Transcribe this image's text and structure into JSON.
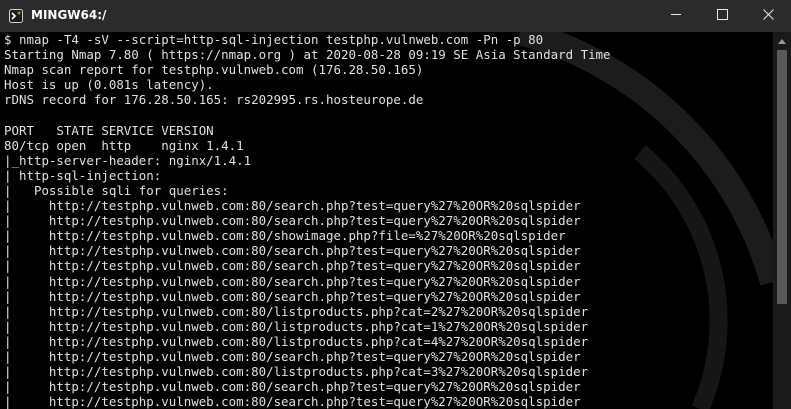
{
  "window": {
    "title": "MINGW64:/",
    "accent": "#2b2b2b"
  },
  "icons": {
    "app": "mingw-terminal-icon",
    "minimize": "minimize-icon",
    "maximize": "maximize-icon",
    "close": "close-icon",
    "scroll_up": "chevron-up-icon"
  },
  "terminal": {
    "lines": [
      "$ nmap -T4 -sV --script=http-sql-injection testphp.vulnweb.com -Pn -p 80",
      "Starting Nmap 7.80 ( https://nmap.org ) at 2020-08-28 09:19 SE Asia Standard Time",
      "Nmap scan report for testphp.vulnweb.com (176.28.50.165)",
      "Host is up (0.081s latency).",
      "rDNS record for 176.28.50.165: rs202995.rs.hosteurope.de",
      "",
      "PORT   STATE SERVICE VERSION",
      "80/tcp open  http    nginx 1.4.1",
      "|_http-server-header: nginx/1.4.1",
      "| http-sql-injection:",
      "|   Possible sqli for queries:",
      "|     http://testphp.vulnweb.com:80/search.php?test=query%27%20OR%20sqlspider",
      "|     http://testphp.vulnweb.com:80/search.php?test=query%27%20OR%20sqlspider",
      "|     http://testphp.vulnweb.com:80/showimage.php?file=%27%20OR%20sqlspider",
      "|     http://testphp.vulnweb.com:80/search.php?test=query%27%20OR%20sqlspider",
      "|     http://testphp.vulnweb.com:80/search.php?test=query%27%20OR%20sqlspider",
      "|     http://testphp.vulnweb.com:80/search.php?test=query%27%20OR%20sqlspider",
      "|     http://testphp.vulnweb.com:80/search.php?test=query%27%20OR%20sqlspider",
      "|     http://testphp.vulnweb.com:80/listproducts.php?cat=2%27%20OR%20sqlspider",
      "|     http://testphp.vulnweb.com:80/listproducts.php?cat=1%27%20OR%20sqlspider",
      "|     http://testphp.vulnweb.com:80/listproducts.php?cat=4%27%20OR%20sqlspider",
      "|     http://testphp.vulnweb.com:80/search.php?test=query%27%20OR%20sqlspider",
      "|     http://testphp.vulnweb.com:80/listproducts.php?cat=3%27%20OR%20sqlspider",
      "|     http://testphp.vulnweb.com:80/search.php?test=query%27%20OR%20sqlspider",
      "|     http://testphp.vulnweb.com:80/search.php?test=query%27%20OR%20sqlspider"
    ]
  }
}
